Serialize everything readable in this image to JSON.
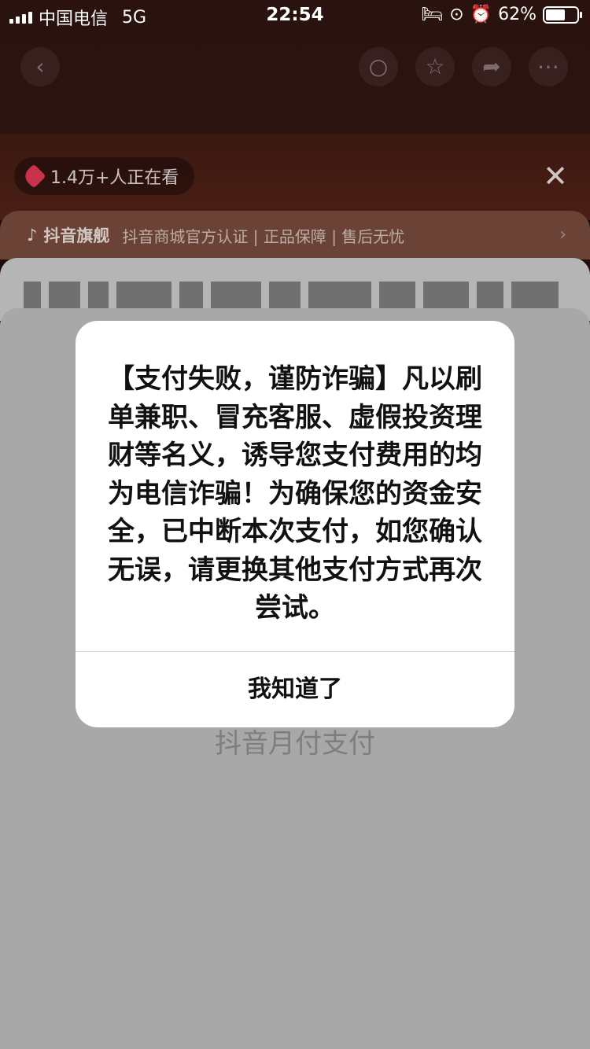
{
  "status_bar": {
    "carrier": "中国电信",
    "network": "5G",
    "time": "22:54",
    "battery_percent": "62%",
    "battery_level": 0.62
  },
  "live": {
    "viewers": "1.4万+人正在看"
  },
  "flagship": {
    "brand": "抖音旗舰",
    "tags": "抖音商城官方认证 | 正品保障 | 售后无忧"
  },
  "payment": {
    "method_label": "抖音月付支付"
  },
  "alert": {
    "message": "【支付失败，谨防诈骗】凡以刷单兼职、冒充客服、虚假投资理财等名义，诱导您支付费用的均为电信诈骗！为确保您的资金安全，已中断本次支付，如您确认无误，请更换其他支付方式再次尝试。",
    "confirm_label": "我知道了"
  },
  "icons": [
    "back-icon",
    "search-icon",
    "star-icon",
    "share-icon",
    "more-icon",
    "close-icon",
    "tiktok-icon"
  ]
}
